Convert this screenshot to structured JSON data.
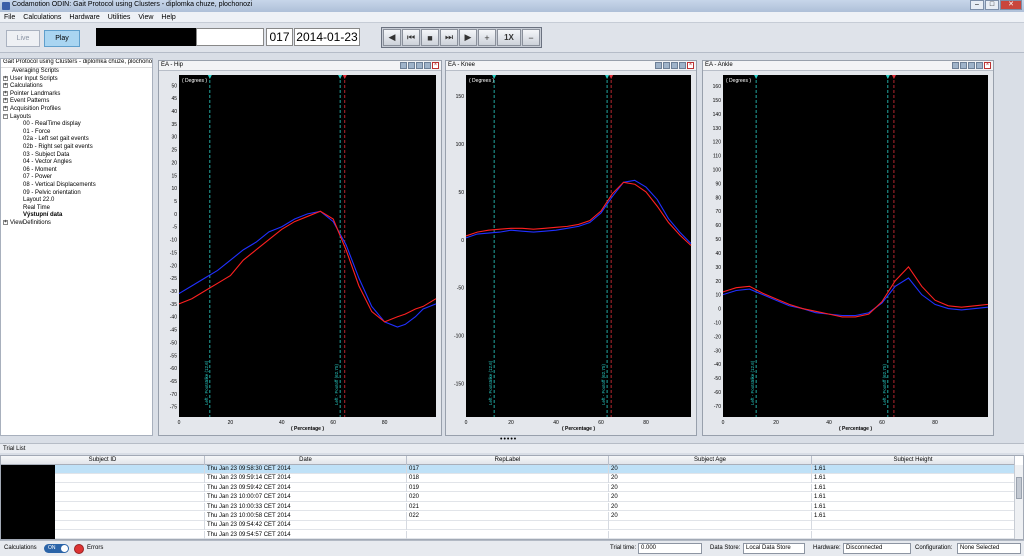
{
  "window": {
    "title": "Codamotion ODIN: Gait Protocol using Clusters - diplomka chuze, plochonozi",
    "buttons": [
      "–",
      "□",
      "✕"
    ]
  },
  "menu": [
    "File",
    "Calculations",
    "Hardware",
    "Utilities",
    "View",
    "Help"
  ],
  "toolbar": {
    "live_label": "Live",
    "play_label": "Play",
    "record_number": "017",
    "date": "2014-01-23",
    "speed_label": "1X",
    "controls": [
      "◀",
      "⏮",
      "■",
      "⏭",
      "▶",
      "+",
      "1X",
      "−"
    ]
  },
  "tree": {
    "root": "Gait Protocol using Clusters - diplomka chuze, plochonozi",
    "items": [
      {
        "label": "Averaging Scripts",
        "level": 1,
        "exp": ""
      },
      {
        "label": "User Input Scripts",
        "level": 1,
        "exp": "+"
      },
      {
        "label": "Calculations",
        "level": 1,
        "exp": "+"
      },
      {
        "label": "Pointer Landmarks",
        "level": 1,
        "exp": "+"
      },
      {
        "label": "Event Patterns",
        "level": 1,
        "exp": "+"
      },
      {
        "label": "Acquisition Profiles",
        "level": 1,
        "exp": "+"
      },
      {
        "label": "Layouts",
        "level": 1,
        "exp": "−"
      },
      {
        "label": "00 - RealTime display",
        "level": 2,
        "exp": ""
      },
      {
        "label": "01 - Force",
        "level": 2,
        "exp": ""
      },
      {
        "label": "02a - Left set gait events",
        "level": 2,
        "exp": ""
      },
      {
        "label": "02b - Right set gait events",
        "level": 2,
        "exp": ""
      },
      {
        "label": "03 - Subject Data",
        "level": 2,
        "exp": ""
      },
      {
        "label": "04 - Vector Angles",
        "level": 2,
        "exp": ""
      },
      {
        "label": "06 - Moment",
        "level": 2,
        "exp": ""
      },
      {
        "label": "07 - Power",
        "level": 2,
        "exp": ""
      },
      {
        "label": "08 - Vertical Displacements",
        "level": 2,
        "exp": ""
      },
      {
        "label": "09 - Pelvic orientation",
        "level": 2,
        "exp": ""
      },
      {
        "label": "Layout 22.0",
        "level": 2,
        "exp": ""
      },
      {
        "label": "Real Time",
        "level": 2,
        "exp": ""
      },
      {
        "label": "Výstupní data",
        "level": 2,
        "exp": "",
        "bold": true
      },
      {
        "label": "ViewDefinitions",
        "level": 1,
        "exp": "+"
      }
    ]
  },
  "chart_data": [
    {
      "type": "line",
      "title": "EA - Hip",
      "unit_label": "( Degrees )",
      "xlabel": "( Percentage )",
      "xlim": [
        0,
        100
      ],
      "ylim": [
        -79,
        54
      ],
      "yticks": [
        50,
        45,
        40,
        35,
        30,
        25,
        20,
        15,
        10,
        5,
        0,
        -5,
        -10,
        -15,
        -20,
        -25,
        -30,
        -35,
        -40,
        -45,
        -50,
        -55,
        -60,
        -65,
        -70,
        -75
      ],
      "xticks": [
        0,
        20,
        40,
        60,
        80
      ],
      "event_lines": [
        {
          "x": 12,
          "color": "#2ad0c8",
          "label": "Left - Footstrike (12.6)"
        },
        {
          "x": 62.7,
          "color": "#2ad0c8",
          "label": "Left - Footoff (62.75)"
        },
        {
          "x": 64.5,
          "color": "#e0303a",
          "label": ""
        }
      ],
      "series": [
        {
          "color": "#2030ff",
          "x": [
            0,
            5,
            10,
            15,
            20,
            25,
            30,
            35,
            40,
            45,
            50,
            55,
            60,
            65,
            70,
            75,
            80,
            85,
            88,
            92,
            95,
            100
          ],
          "y": [
            -31,
            -28,
            -25,
            -22,
            -18,
            -14,
            -11,
            -7,
            -5,
            -2,
            0,
            1,
            -3,
            -12,
            -25,
            -36,
            -42,
            -44,
            -43,
            -40,
            -37,
            -35
          ]
        },
        {
          "color": "#ff2020",
          "x": [
            0,
            5,
            10,
            15,
            20,
            25,
            30,
            35,
            40,
            45,
            50,
            55,
            60,
            65,
            70,
            75,
            80,
            85,
            88,
            92,
            95,
            100
          ],
          "y": [
            -35,
            -33,
            -30,
            -27,
            -24,
            -18,
            -14,
            -10,
            -6,
            -3,
            -1,
            1,
            -2,
            -14,
            -28,
            -38,
            -42,
            -40,
            -39,
            -37,
            -36,
            -33
          ]
        }
      ]
    },
    {
      "type": "line",
      "title": "EA - Knee",
      "unit_label": "( Degrees )",
      "xlabel": "( Percentage )",
      "xlim": [
        0,
        100
      ],
      "ylim": [
        -185,
        172
      ],
      "yticks": [
        150,
        100,
        50,
        0,
        -50,
        -100,
        -150
      ],
      "xticks": [
        0,
        20,
        40,
        60,
        80
      ],
      "event_lines": [
        {
          "x": 12.5,
          "color": "#2ad0c8",
          "label": "Left - Footstrike (12.6)"
        },
        {
          "x": 62.7,
          "color": "#2ad0c8",
          "label": "Left - Footoff (62.75)"
        },
        {
          "x": 64.5,
          "color": "#e0303a",
          "label": ""
        }
      ],
      "series": [
        {
          "color": "#2030ff",
          "x": [
            0,
            5,
            10,
            15,
            20,
            25,
            30,
            35,
            40,
            45,
            50,
            55,
            60,
            65,
            70,
            75,
            80,
            85,
            90,
            95,
            100
          ],
          "y": [
            2,
            6,
            7,
            8,
            10,
            9,
            8,
            9,
            10,
            12,
            14,
            18,
            28,
            45,
            60,
            62,
            55,
            42,
            22,
            8,
            -4
          ]
        },
        {
          "color": "#ff2020",
          "x": [
            0,
            5,
            10,
            15,
            20,
            25,
            30,
            35,
            40,
            45,
            50,
            55,
            60,
            65,
            70,
            75,
            80,
            85,
            90,
            95,
            100
          ],
          "y": [
            4,
            8,
            10,
            11,
            12,
            12,
            11,
            12,
            13,
            14,
            16,
            20,
            30,
            48,
            60,
            58,
            50,
            35,
            18,
            5,
            -6
          ]
        }
      ]
    },
    {
      "type": "line",
      "title": "EA - Ankle",
      "unit_label": "( Degrees )",
      "xlabel": "( Percentage )",
      "xlim": [
        0,
        100
      ],
      "ylim": [
        -78,
        168
      ],
      "yticks": [
        160,
        150,
        140,
        130,
        120,
        110,
        100,
        90,
        80,
        70,
        60,
        50,
        40,
        30,
        20,
        10,
        0,
        -10,
        -20,
        -30,
        -40,
        -50,
        -60,
        -70
      ],
      "xticks": [
        0,
        20,
        40,
        60,
        80
      ],
      "event_lines": [
        {
          "x": 12.5,
          "color": "#2ad0c8",
          "label": "Left - Footstrike (12.6)"
        },
        {
          "x": 62.2,
          "color": "#2ad0c8",
          "label": "Left - Footoff (62.75)"
        },
        {
          "x": 64.5,
          "color": "#e0303a",
          "label": ""
        }
      ],
      "series": [
        {
          "color": "#2030ff",
          "x": [
            0,
            5,
            10,
            15,
            20,
            25,
            30,
            35,
            40,
            45,
            50,
            55,
            60,
            65,
            70,
            75,
            80,
            85,
            90,
            95,
            100
          ],
          "y": [
            10,
            13,
            14,
            10,
            6,
            2,
            0,
            -3,
            -4,
            -5,
            -5,
            -3,
            4,
            16,
            22,
            10,
            3,
            0,
            -1,
            0,
            1
          ]
        },
        {
          "color": "#ff2020",
          "x": [
            0,
            5,
            10,
            15,
            20,
            25,
            30,
            35,
            40,
            45,
            50,
            55,
            60,
            65,
            70,
            75,
            80,
            85,
            90,
            95,
            100
          ],
          "y": [
            12,
            15,
            16,
            11,
            7,
            3,
            0,
            -2,
            -4,
            -6,
            -6,
            -4,
            5,
            20,
            30,
            16,
            6,
            2,
            1,
            2,
            3
          ]
        }
      ]
    }
  ],
  "trial_list": {
    "title": "Trial List",
    "columns": [
      "Subject ID",
      "Date",
      "RepLabel",
      "Subject Age",
      "Subject Height"
    ],
    "rows": [
      {
        "date": "Thu Jan 23 09:58:30 CET 2014",
        "rep": "017",
        "age": "20",
        "height": "1.61",
        "selected": true
      },
      {
        "date": "Thu Jan 23 09:59:14 CET 2014",
        "rep": "018",
        "age": "20",
        "height": "1.61"
      },
      {
        "date": "Thu Jan 23 09:59:42 CET 2014",
        "rep": "019",
        "age": "20",
        "height": "1.61"
      },
      {
        "date": "Thu Jan 23 10:00:07 CET 2014",
        "rep": "020",
        "age": "20",
        "height": "1.61"
      },
      {
        "date": "Thu Jan 23 10:00:33 CET 2014",
        "rep": "021",
        "age": "20",
        "height": "1.61"
      },
      {
        "date": "Thu Jan 23 10:00:58 CET 2014",
        "rep": "022",
        "age": "20",
        "height": "1.61"
      },
      {
        "date": "Thu Jan 23 09:54:42 CET 2014",
        "rep": "",
        "age": "",
        "height": ""
      },
      {
        "date": "Thu Jan 23 09:54:57 CET 2014",
        "rep": "",
        "age": "",
        "height": ""
      }
    ]
  },
  "status": {
    "calculations_label": "Calculations",
    "calculations_toggle": "ON",
    "errors_label": "Errors",
    "trial_time_label": "Trial time:",
    "trial_time": "0.000",
    "data_store_label": "Data Store:",
    "data_store": "Local Data Store",
    "hardware_label": "Hardware:",
    "hardware": "Disconnected",
    "configuration_label": "Configuration:",
    "configuration": "None Selected"
  }
}
